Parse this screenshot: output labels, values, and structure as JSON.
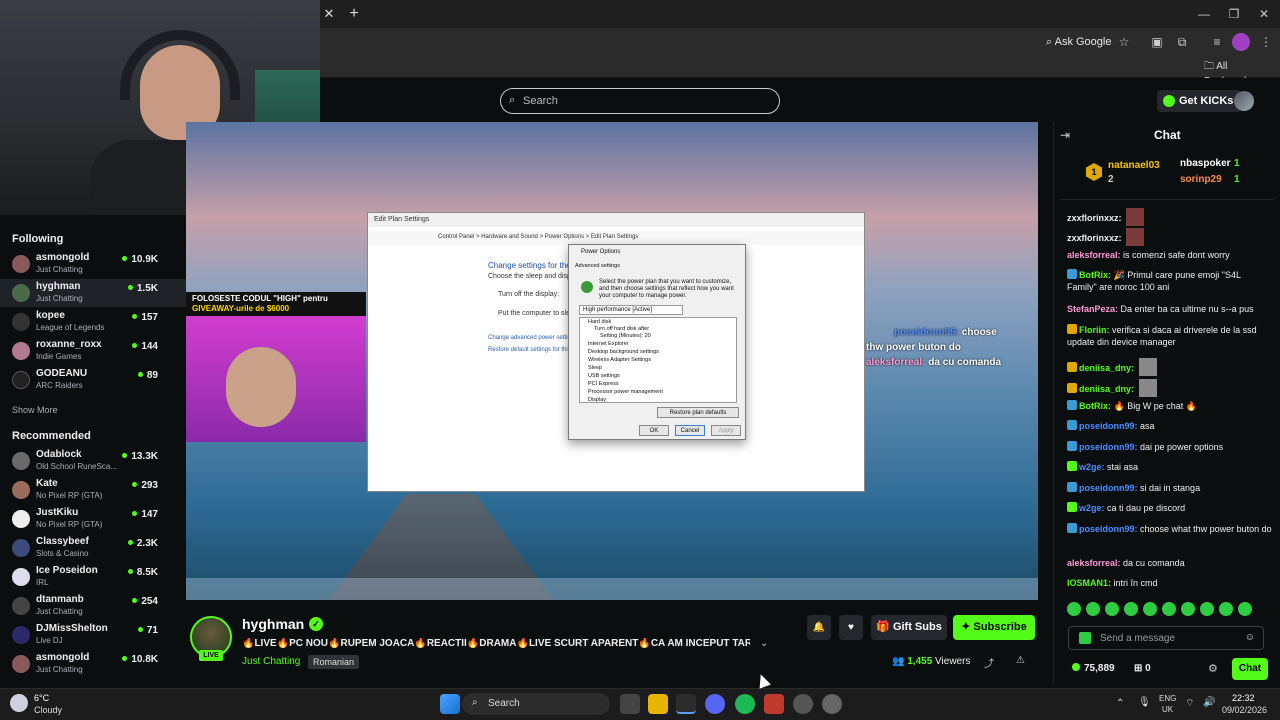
{
  "browser": {
    "ask_google": "Ask Google",
    "all_bookmarks": "All Bookmarks",
    "new_tab": "+",
    "close_tab": "✕"
  },
  "kick": {
    "search_placeholder": "Search",
    "get_kicks": "Get KICKs"
  },
  "sidebar": {
    "following_label": "Following",
    "following": [
      {
        "name": "asmongold",
        "category": "Just Chatting",
        "viewers": "10.9K"
      },
      {
        "name": "hyghman",
        "category": "Just Chatting",
        "viewers": "1.5K"
      },
      {
        "name": "kopee",
        "category": "League of Legends",
        "viewers": "157"
      },
      {
        "name": "roxanne_roxx",
        "category": "Indie Games",
        "viewers": "144"
      },
      {
        "name": "GODEANU",
        "category": "ARC Raiders",
        "viewers": "89"
      }
    ],
    "show_more": "Show More",
    "recommended_label": "Recommended",
    "recommended": [
      {
        "name": "Odablock",
        "category": "Old School RuneSca...",
        "viewers": "13.3K"
      },
      {
        "name": "Kate",
        "category": "No Pixel RP (GTA)",
        "viewers": "293"
      },
      {
        "name": "JustKiku",
        "category": "No Pixel RP (GTA)",
        "viewers": "147"
      },
      {
        "name": "Classybeef",
        "category": "Slots & Casino",
        "viewers": "2.3K"
      },
      {
        "name": "Ice Poseidon",
        "category": "IRL",
        "viewers": "8.5K"
      },
      {
        "name": "dtanmanb",
        "category": "Just Chatting",
        "viewers": "254"
      },
      {
        "name": "DJMissShelton",
        "category": "Live DJ",
        "viewers": "71"
      },
      {
        "name": "asmongold",
        "category": "Just Chatting",
        "viewers": "10.8K"
      }
    ]
  },
  "video": {
    "banner_line1": "FOLOSESTE CODUL \"HIGH\" pentru",
    "banner_line2": "GIVEAWAY-urile de $6000",
    "plan_title": "Edit Plan Settings",
    "plan_addr": "Control Panel  >  Hardware and Sound  >  Power Options  >  Edit Plan Settings",
    "plan_heading": "Change settings for the pla",
    "plan_sub": "Choose the sleep and display setti",
    "plan_display": "Turn off the display:",
    "plan_sleep": "Put the computer to sleep:",
    "plan_link1": "Change advanced power settings",
    "plan_link2": "Restore default settings for this pla",
    "po_title": "Power Options",
    "po_tab": "Advanced settings",
    "po_desc": "Select the power plan that you want to customize, and then choose settings that reflect how you want your computer to manage power.",
    "po_plan": "High performance [Active]",
    "po_tree": [
      "Hard disk",
      "Turn off hard disk after",
      "Setting (Minutes): 20",
      "Internet Explorer",
      "Desktop background settings",
      "Wireless Adapter Settings",
      "Sleep",
      "USB settings",
      "PCI Express",
      "Processor power management",
      "Display"
    ],
    "po_restore": "Restore plan defaults",
    "po_ok": "OK",
    "po_cancel": "Cancel",
    "po_apply": "Apply",
    "overlay1_user": "poseidonn99:",
    "overlay1_text": "choose",
    "overlay2": "thw power buton do",
    "overlay3_user": "aleksforreal:",
    "overlay3_text": "da cu comanda"
  },
  "stream": {
    "streamer": "hyghman",
    "live": "LIVE",
    "title": "🔥LIVE🔥PC NOU🔥RUPEM JOACA🔥REACTII🔥DRAMA🔥LIVE SCURT APARENT🔥CA AM INCEPUT TARZIU...",
    "category": "Just Chatting",
    "language": "Romanian",
    "gift_subs": "Gift Subs",
    "subscribe": "Subscribe",
    "viewers_count": "1,455",
    "viewers_label": "Viewers"
  },
  "chat": {
    "title": "Chat",
    "pinned": [
      {
        "name": "natanael03",
        "value": "2"
      },
      {
        "name": "nbaspoker",
        "value": "1"
      },
      {
        "name": "sorinp29",
        "value": "1"
      }
    ],
    "rank_badge": "1",
    "messages": [
      {
        "user": "zxxflorinxxz:",
        "text": "",
        "color": "#efeff1"
      },
      {
        "user": "zxxflorinxxz:",
        "text": "",
        "color": "#efeff1"
      },
      {
        "user": "aleksforreal:",
        "text": "is comenzi safe dont worry",
        "color": "#efeff1"
      },
      {
        "user": "BotRix:",
        "text": "🎉 Primul care pune emoji \"S4L Family\" are noroc 100 ani",
        "color": "#53fc18"
      },
      {
        "user": "StefanPeza:",
        "text": "Da enter ba ca ultime nu s--a pus",
        "color": "#ff9ad5"
      },
      {
        "user": "Floriin:",
        "text": "verifica si daca ai driverele de la ssd update din device manager",
        "color": "#53fc18"
      },
      {
        "user": "deniisa_dny:",
        "text": "",
        "color": "#53fc18"
      },
      {
        "user": "deniisa_dny:",
        "text": "",
        "color": "#53fc18"
      },
      {
        "user": "BotRix:",
        "text": "🔥 Big W pe chat 🔥",
        "color": "#53fc18"
      },
      {
        "user": "poseidonn99:",
        "text": "asa",
        "color": "#4a8cff"
      },
      {
        "user": "poseidonn99:",
        "text": "dai pe power options",
        "color": "#4a8cff"
      },
      {
        "user": "w2ge:",
        "text": "stai asa",
        "color": "#4a8cff"
      },
      {
        "user": "poseidonn99:",
        "text": "si dai in stanga",
        "color": "#4a8cff"
      },
      {
        "user": "w2ge:",
        "text": "ca ti dau pe discord",
        "color": "#4a8cff"
      },
      {
        "user": "poseidonn99:",
        "text": "choose what thw power buton do",
        "color": "#4a8cff"
      },
      {
        "user": "aleksforreal:",
        "text": "da cu comanda",
        "color": "#ff9ad5"
      },
      {
        "user": "IOSMAN1:",
        "text": "intri în cmd",
        "color": "#53fc18"
      }
    ],
    "input_placeholder": "Send a message",
    "kicks": "75,889",
    "gifts": "0",
    "chat_button": "Chat"
  },
  "os": {
    "temp": "6°C",
    "weather": "Cloudy",
    "search": "Search",
    "lang1": "ENG",
    "lang2": "UK",
    "time": "22:32",
    "date": "09/02/2026"
  }
}
